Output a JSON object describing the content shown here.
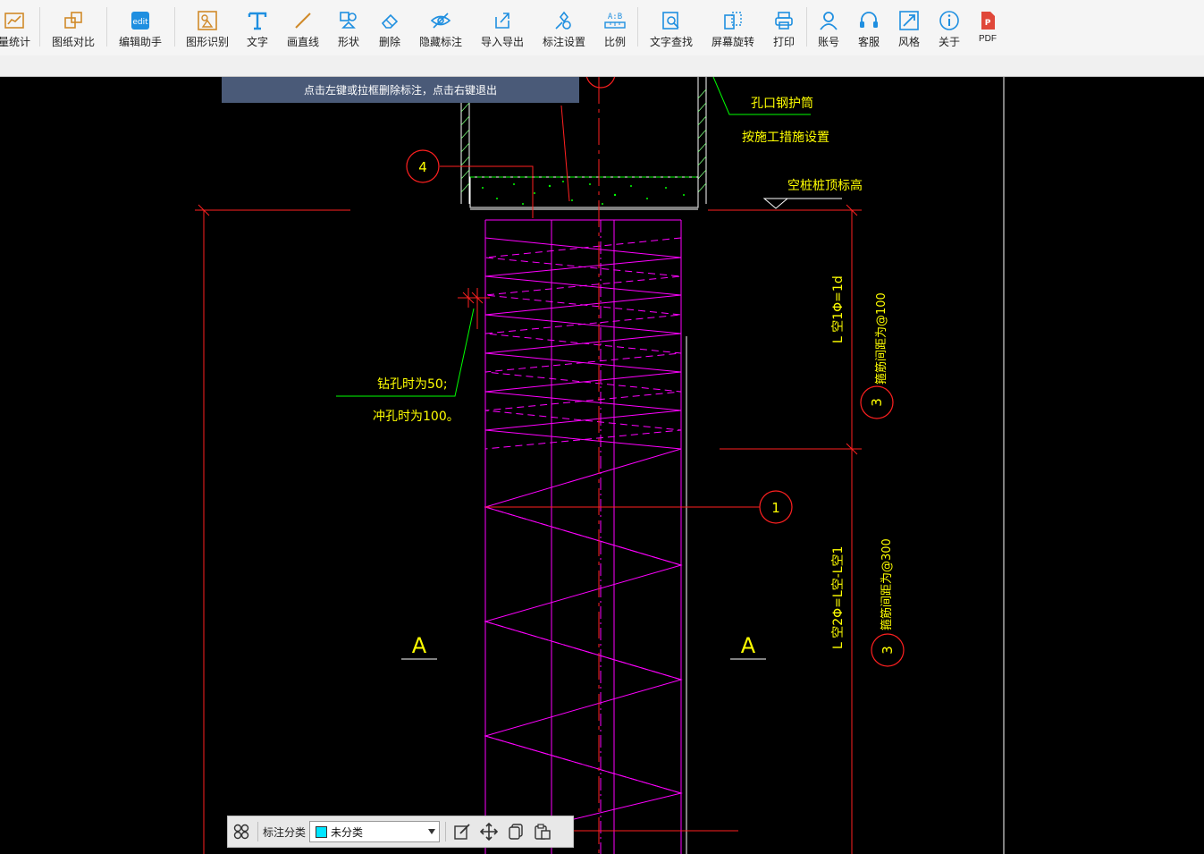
{
  "toolbar": {
    "items": [
      {
        "label": "量统计",
        "icon": "stats-icon"
      },
      {
        "label": "图纸对比",
        "icon": "compare-icon"
      },
      {
        "label": "编辑助手",
        "icon": "edit-assistant-icon"
      },
      {
        "label": "图形识别",
        "icon": "shape-recognize-icon"
      },
      {
        "label": "文字",
        "icon": "text-icon"
      },
      {
        "label": "画直线",
        "icon": "line-icon"
      },
      {
        "label": "形状",
        "icon": "shape-icon"
      },
      {
        "label": "删除",
        "icon": "eraser-icon"
      },
      {
        "label": "隐藏标注",
        "icon": "eye-hide-icon"
      },
      {
        "label": "导入导出",
        "icon": "import-export-icon"
      },
      {
        "label": "标注设置",
        "icon": "annotation-settings-icon"
      },
      {
        "label": "比例",
        "icon": "scale-icon"
      },
      {
        "label": "文字查找",
        "icon": "text-search-icon"
      },
      {
        "label": "屏幕旋转",
        "icon": "rotate-icon"
      },
      {
        "label": "打印",
        "icon": "print-icon"
      },
      {
        "label": "账号",
        "icon": "account-icon"
      },
      {
        "label": "客服",
        "icon": "headset-icon"
      },
      {
        "label": "风格",
        "icon": "style-icon"
      },
      {
        "label": "关于",
        "icon": "info-icon"
      },
      {
        "label": "PDF",
        "icon": "pdf-icon"
      }
    ]
  },
  "hint": {
    "text": "点击左键或拉框删除标注，点击右键退出"
  },
  "drawing": {
    "texts": {
      "casing": "孔口钢护筒",
      "casing_note": "按施工措施设置",
      "pile_top": "空桩桩顶标高",
      "drill_note1": "钻孔时为50;",
      "drill_note2": "冲孔时为100。",
      "len1": "L 空1Φ=1d",
      "len2": "L 空2Φ=L空-L空1",
      "stirrup1": "箍筋间距为@100",
      "stirrup2": "箍筋间距为@300",
      "section_left": "A",
      "section_right": "A",
      "bubble_4": "4",
      "bubble_1": "1",
      "bubble_3a": "3",
      "bubble_3b": "3"
    }
  },
  "bottom_bar": {
    "category_label": "标注分类",
    "category_value": "未分类",
    "category_color": "#00e5ff"
  },
  "colors": {
    "magenta": "#ff00ff",
    "red": "#ff2020",
    "yellow": "#ffff00",
    "green": "#00ff00",
    "white": "#ffffff"
  }
}
